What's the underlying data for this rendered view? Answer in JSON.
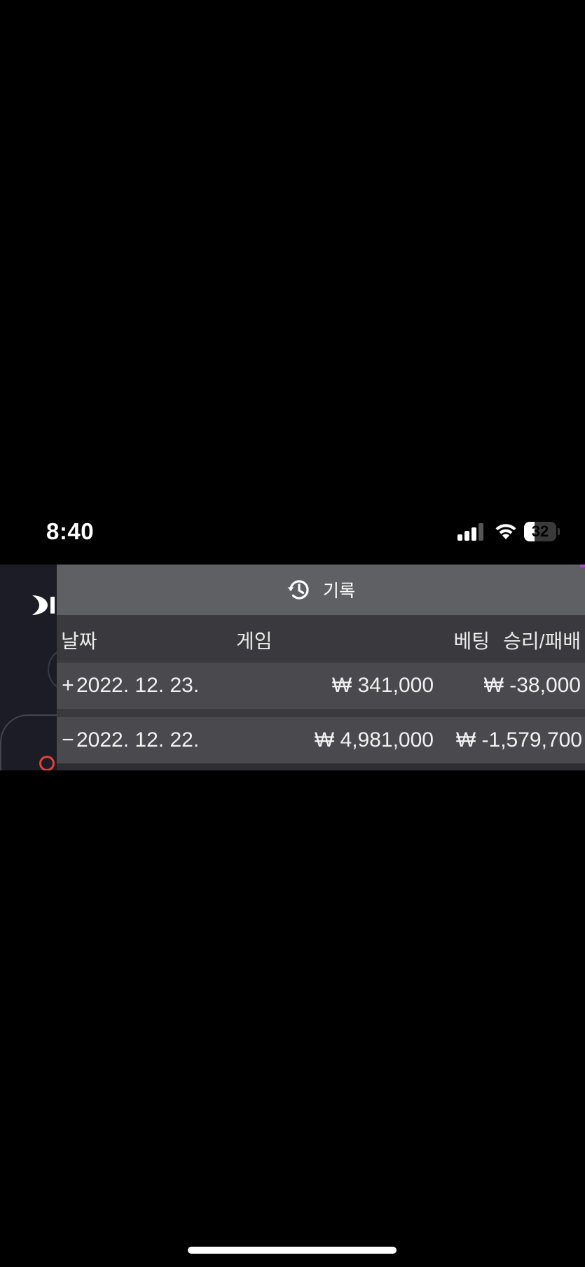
{
  "status_bar": {
    "time": "8:40",
    "battery_level": "32",
    "battery_fraction": 0.32
  },
  "history": {
    "title": "기록",
    "icon": "history-icon",
    "columns": {
      "date": "날짜",
      "game": "게임",
      "bet": "베팅",
      "result": "승리/패배"
    },
    "rows": [
      {
        "toggle": "+",
        "date": "2022. 12. 23.",
        "bet": "₩ 341,000",
        "result": "₩ -38,000"
      },
      {
        "toggle": "−",
        "date": "2022. 12. 22.",
        "bet": "₩ 4,981,000",
        "result": "₩ -1,579,700"
      }
    ]
  },
  "colors": {
    "background": "#000000",
    "panel_header": "#5f6064",
    "row": "#4a4a4e",
    "accent": "#b04bd6"
  }
}
